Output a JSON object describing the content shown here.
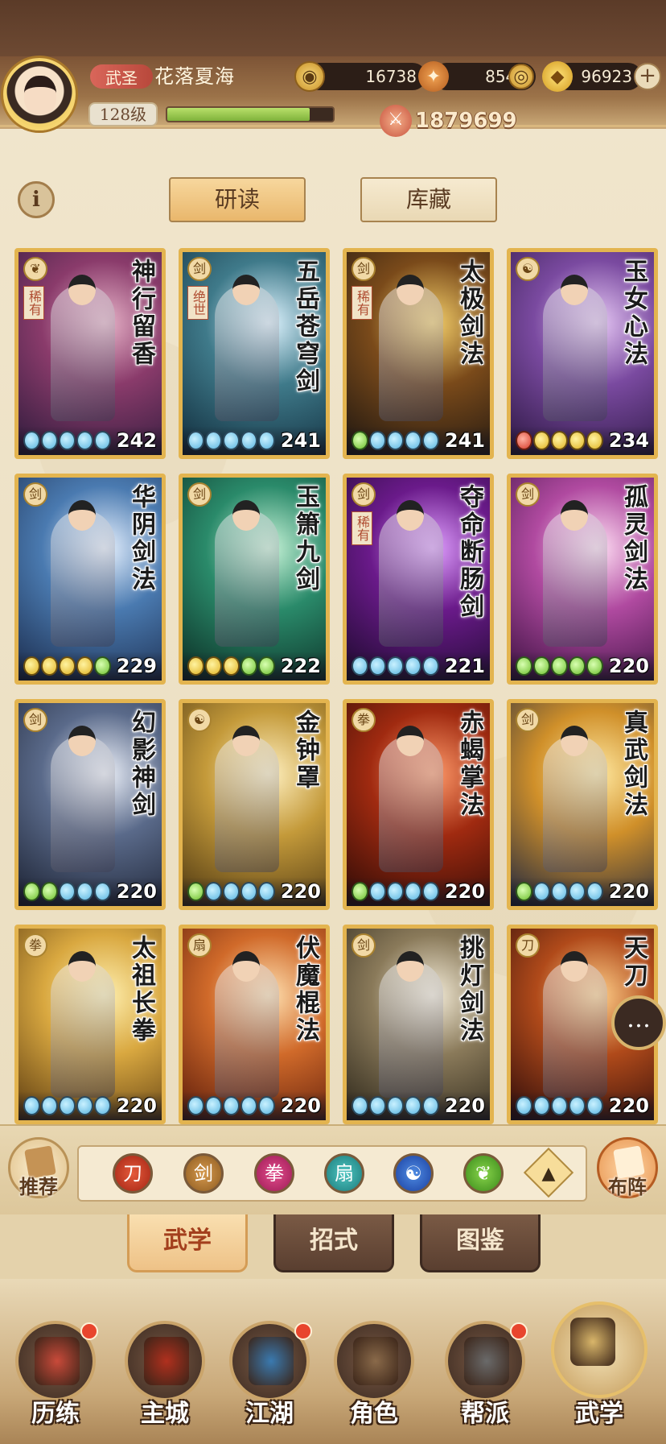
{
  "header": {
    "rank_title": "武圣",
    "player_name": "花落夏海",
    "level": "128级",
    "exp_fraction": 0.86,
    "currencies": [
      {
        "icon": "coin-icon",
        "value": "16738"
      },
      {
        "icon": "maple-leaf-icon",
        "value": "8544"
      },
      {
        "icon": "gold-ingot-icon",
        "value": "96923"
      }
    ],
    "plus_label": "+",
    "combat_power": "1879699"
  },
  "subtabs": {
    "info_label": "i",
    "study_label": "研读",
    "collection_label": "库藏"
  },
  "cards": [
    {
      "name": "神行留香",
      "type_icon": "leaf-type-icon",
      "tag": "稀有",
      "level": "242",
      "drops": [
        "blue",
        "blue",
        "blue",
        "blue",
        "blue"
      ],
      "palette": [
        "#2b1a3a",
        "#8a3b6b",
        "#e7b3c8"
      ]
    },
    {
      "name": "五岳苍穹剑",
      "type_icon": "sword-type-icon",
      "tag": "绝世",
      "level": "241",
      "drops": [
        "blue",
        "blue",
        "blue",
        "blue",
        "blue"
      ],
      "palette": [
        "#0f2a3a",
        "#3f7a8a",
        "#dff4ff"
      ]
    },
    {
      "name": "太极剑法",
      "type_icon": "sword-type-icon",
      "tag": "稀有",
      "level": "241",
      "drops": [
        "green",
        "blue",
        "blue",
        "blue",
        "blue"
      ],
      "palette": [
        "#1a1410",
        "#7a4a1a",
        "#f4cf6a"
      ]
    },
    {
      "name": "玉女心法",
      "type_icon": "taiji-type-icon",
      "tag": "",
      "level": "234",
      "drops": [
        "red",
        "yellow",
        "yellow",
        "yellow",
        "yellow"
      ],
      "palette": [
        "#2a1640",
        "#7a4aa0",
        "#e6c8f4"
      ]
    },
    {
      "name": "华阴剑法",
      "type_icon": "sword-type-icon",
      "tag": "",
      "level": "229",
      "drops": [
        "yellow",
        "yellow",
        "yellow",
        "yellow",
        "green"
      ],
      "palette": [
        "#1a2a4a",
        "#4a7ab0",
        "#e8f2ff"
      ]
    },
    {
      "name": "玉箫九剑",
      "type_icon": "sword-type-icon",
      "tag": "",
      "level": "222",
      "drops": [
        "yellow",
        "yellow",
        "yellow",
        "green",
        "green"
      ],
      "palette": [
        "#0a2a22",
        "#2a8a6a",
        "#c8f4d8"
      ]
    },
    {
      "name": "夺命断肠剑",
      "type_icon": "sword-type-icon",
      "tag": "稀有",
      "level": "221",
      "drops": [
        "blue",
        "blue",
        "blue",
        "blue",
        "blue"
      ],
      "palette": [
        "#1a0a2a",
        "#6a1a8a",
        "#e0a0ff"
      ]
    },
    {
      "name": "孤灵剑法",
      "type_icon": "sword-type-icon",
      "tag": "",
      "level": "220",
      "drops": [
        "green",
        "green",
        "green",
        "green",
        "green"
      ],
      "palette": [
        "#3a1040",
        "#b04aa0",
        "#ffe0f4"
      ]
    },
    {
      "name": "幻影神剑",
      "type_icon": "sword-type-icon",
      "tag": "",
      "level": "220",
      "drops": [
        "green",
        "green",
        "blue",
        "blue",
        "blue"
      ],
      "palette": [
        "#1a2030",
        "#5a6a8a",
        "#eef2fa"
      ]
    },
    {
      "name": "金钟罩",
      "type_icon": "taiji-type-icon",
      "tag": "",
      "level": "220",
      "drops": [
        "green",
        "blue",
        "blue",
        "blue",
        "blue"
      ],
      "palette": [
        "#4a3410",
        "#c49a3a",
        "#fff0c0"
      ]
    },
    {
      "name": "赤蝎掌法",
      "type_icon": "fist-type-icon",
      "tag": "",
      "level": "220",
      "drops": [
        "green",
        "blue",
        "blue",
        "blue",
        "blue"
      ],
      "palette": [
        "#2a0a06",
        "#a02a10",
        "#ff9a6a"
      ]
    },
    {
      "name": "真武剑法",
      "type_icon": "sword-type-icon",
      "tag": "",
      "level": "220",
      "drops": [
        "green",
        "blue",
        "blue",
        "blue",
        "blue"
      ],
      "palette": [
        "#1a2440",
        "#d0902a",
        "#ffe8a0"
      ]
    },
    {
      "name": "太祖长拳",
      "type_icon": "fist-type-icon",
      "tag": "",
      "level": "220",
      "drops": [
        "blue",
        "blue",
        "blue",
        "blue",
        "blue"
      ],
      "palette": [
        "#5a3a10",
        "#d9a840",
        "#fff0b0"
      ]
    },
    {
      "name": "伏魔棍法",
      "type_icon": "fan-type-icon",
      "tag": "",
      "level": "220",
      "drops": [
        "blue",
        "blue",
        "blue",
        "blue",
        "blue"
      ],
      "palette": [
        "#5a1a0a",
        "#d06a2a",
        "#ffe0b0"
      ]
    },
    {
      "name": "挑灯剑法",
      "type_icon": "sword-type-icon",
      "tag": "",
      "level": "220",
      "drops": [
        "blue",
        "blue",
        "blue",
        "blue",
        "blue"
      ],
      "palette": [
        "#2a2418",
        "#8a7a5a",
        "#f4ecd8"
      ]
    },
    {
      "name": "天刀",
      "type_icon": "blade-type-icon",
      "tag": "",
      "level": "220",
      "drops": [
        "blue",
        "blue",
        "blue",
        "blue",
        "blue"
      ],
      "palette": [
        "#2a0a0a",
        "#b04a1a",
        "#ffd08a"
      ]
    }
  ],
  "filter_bar": {
    "recommend_label": "推荐",
    "formation_label": "布阵",
    "icons": [
      {
        "name": "blade-filter-icon",
        "glyph": "刀"
      },
      {
        "name": "sword-filter-icon",
        "glyph": "剑"
      },
      {
        "name": "fist-filter-icon",
        "glyph": "拳"
      },
      {
        "name": "fan-filter-icon",
        "glyph": "扇"
      },
      {
        "name": "taiji-filter-icon",
        "glyph": "☯"
      },
      {
        "name": "leaf-filter-icon",
        "glyph": "❦"
      }
    ],
    "more_glyph": "▲"
  },
  "chat_glyph": "…",
  "main_tabs": [
    {
      "label": "武学",
      "active": true
    },
    {
      "label": "招式",
      "active": false
    },
    {
      "label": "图鉴",
      "active": false
    }
  ],
  "bottom_nav": [
    {
      "label": "历练",
      "badge": true,
      "art": "#c94a3a",
      "active": false
    },
    {
      "label": "主城",
      "badge": false,
      "art": "#b0301e",
      "active": false
    },
    {
      "label": "江湖",
      "badge": true,
      "art": "#3a7ab0",
      "active": false
    },
    {
      "label": "角色",
      "badge": false,
      "art": "#8a6a4a",
      "active": false
    },
    {
      "label": "帮派",
      "badge": true,
      "art": "#6a6a6a",
      "active": false
    },
    {
      "label": "武学",
      "badge": false,
      "art": "#d9b66a",
      "active": true
    }
  ],
  "colors": {
    "card_border": "#e3b44f",
    "exp_fill": "#9ccf4f",
    "active_tab_text": "#a33f1d"
  }
}
